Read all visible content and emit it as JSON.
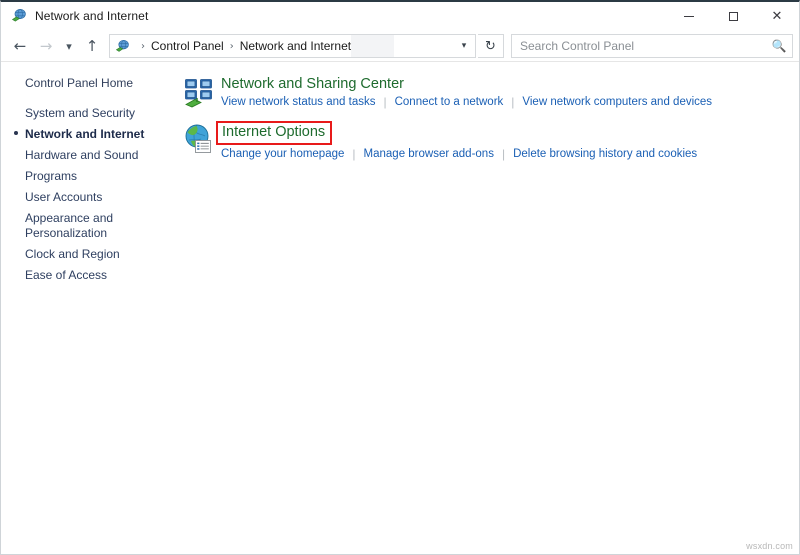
{
  "window": {
    "title": "Network and Internet",
    "title_icon": "network-globe-icon",
    "controls": {
      "minimize": "minimize-icon",
      "maximize": "maximize-icon",
      "close": "close-icon"
    }
  },
  "navbar": {
    "back": "back-arrow-icon",
    "forward": "forward-arrow-icon",
    "recent": "chevron-down-icon",
    "up": "up-arrow-icon",
    "breadcrumb_icon": "network-globe-icon",
    "breadcrumb": [
      "Control Panel",
      "Network and Internet"
    ],
    "breadcrumb_separator": "›",
    "dropdown": "chevron-down-icon",
    "refresh": "refresh-icon",
    "search": {
      "placeholder": "Search Control Panel",
      "value": "",
      "icon": "search-icon"
    }
  },
  "sidebar": {
    "items": [
      {
        "label": "Control Panel Home",
        "active": false
      },
      {
        "label": "System and Security",
        "active": false
      },
      {
        "label": "Network and Internet",
        "active": true
      },
      {
        "label": "Hardware and Sound",
        "active": false
      },
      {
        "label": "Programs",
        "active": false
      },
      {
        "label": "User Accounts",
        "active": false
      },
      {
        "label": "Appearance and Personalization",
        "active": false
      },
      {
        "label": "Clock and Region",
        "active": false
      },
      {
        "label": "Ease of Access",
        "active": false
      }
    ]
  },
  "main": {
    "categories": [
      {
        "title": "Network and Sharing Center",
        "icon": "network-computers-icon",
        "highlighted": false,
        "links": [
          "View network status and tasks",
          "Connect to a network",
          "View network computers and devices"
        ]
      },
      {
        "title": "Internet Options",
        "icon": "internet-options-globe-icon",
        "highlighted": true,
        "links": [
          "Change your homepage",
          "Manage browser add-ons",
          "Delete browsing history and cookies"
        ]
      }
    ]
  },
  "watermark": "wsxdn.com",
  "colors": {
    "category_title": "#1e6b2e",
    "link": "#1a5fb4",
    "highlight_box": "#e81a1a",
    "sidebar_text": "#2e3f60",
    "titlebar_border": "#2b3a44"
  }
}
